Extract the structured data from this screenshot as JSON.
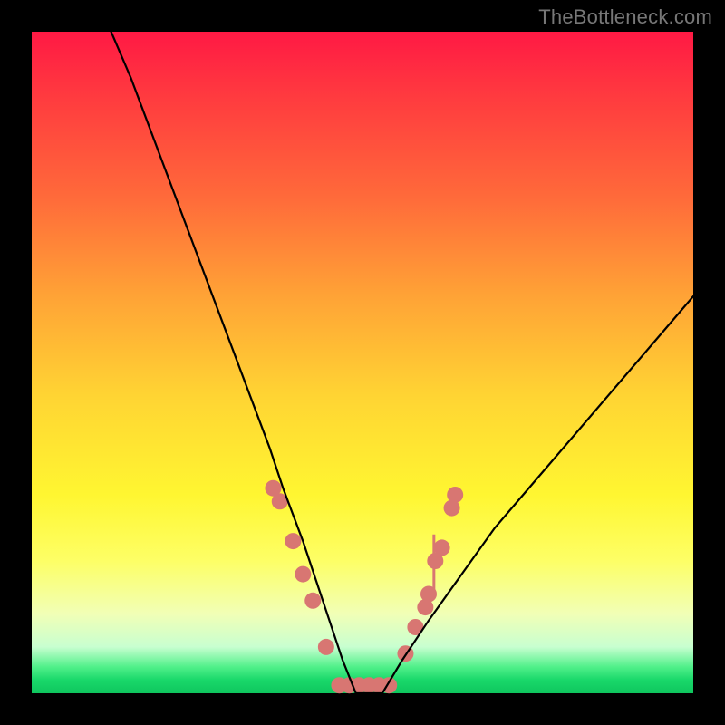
{
  "watermark": "TheBottleneck.com",
  "chart_data": {
    "type": "line",
    "title": "",
    "xlabel": "",
    "ylabel": "",
    "xlim": [
      0,
      100
    ],
    "ylim": [
      0,
      100
    ],
    "grid": false,
    "series": [
      {
        "name": "bottleneck-curve",
        "color": "#000000",
        "x": [
          12,
          15,
          18,
          21,
          24,
          27,
          30,
          33,
          36,
          38,
          41,
          43,
          45,
          47,
          49,
          51,
          53,
          56,
          60,
          65,
          70,
          76,
          82,
          88,
          94,
          100
        ],
        "y": [
          100,
          93,
          85,
          77,
          69,
          61,
          53,
          45,
          37,
          31,
          23,
          17,
          11,
          5,
          0,
          0,
          0,
          5,
          11,
          18,
          25,
          32,
          39,
          46,
          53,
          60
        ]
      }
    ],
    "markers": [
      {
        "name": "left-cluster-points",
        "color": "#d87672",
        "shape": "circle",
        "points": [
          {
            "x": 36.5,
            "y": 31
          },
          {
            "x": 37.5,
            "y": 29
          },
          {
            "x": 39.5,
            "y": 23
          },
          {
            "x": 41.0,
            "y": 18
          },
          {
            "x": 42.5,
            "y": 14
          },
          {
            "x": 44.5,
            "y": 7
          }
        ]
      },
      {
        "name": "bottom-cluster-points",
        "color": "#d87672",
        "shape": "circle",
        "points": [
          {
            "x": 46.5,
            "y": 1.2
          },
          {
            "x": 48.0,
            "y": 1.2
          },
          {
            "x": 49.5,
            "y": 1.2
          },
          {
            "x": 51.0,
            "y": 1.2
          },
          {
            "x": 52.5,
            "y": 1.2
          },
          {
            "x": 54.0,
            "y": 1.2
          }
        ]
      },
      {
        "name": "right-cluster-points",
        "color": "#d87672",
        "shape": "circle",
        "points": [
          {
            "x": 56.5,
            "y": 6
          },
          {
            "x": 58.0,
            "y": 10
          },
          {
            "x": 59.5,
            "y": 13
          },
          {
            "x": 60.0,
            "y": 15
          },
          {
            "x": 61.0,
            "y": 20
          },
          {
            "x": 62.0,
            "y": 22
          },
          {
            "x": 63.5,
            "y": 28
          },
          {
            "x": 64.0,
            "y": 30
          }
        ]
      }
    ],
    "spike": {
      "color": "#d87672",
      "x": 60.8,
      "y0": 15,
      "y1": 24
    }
  }
}
